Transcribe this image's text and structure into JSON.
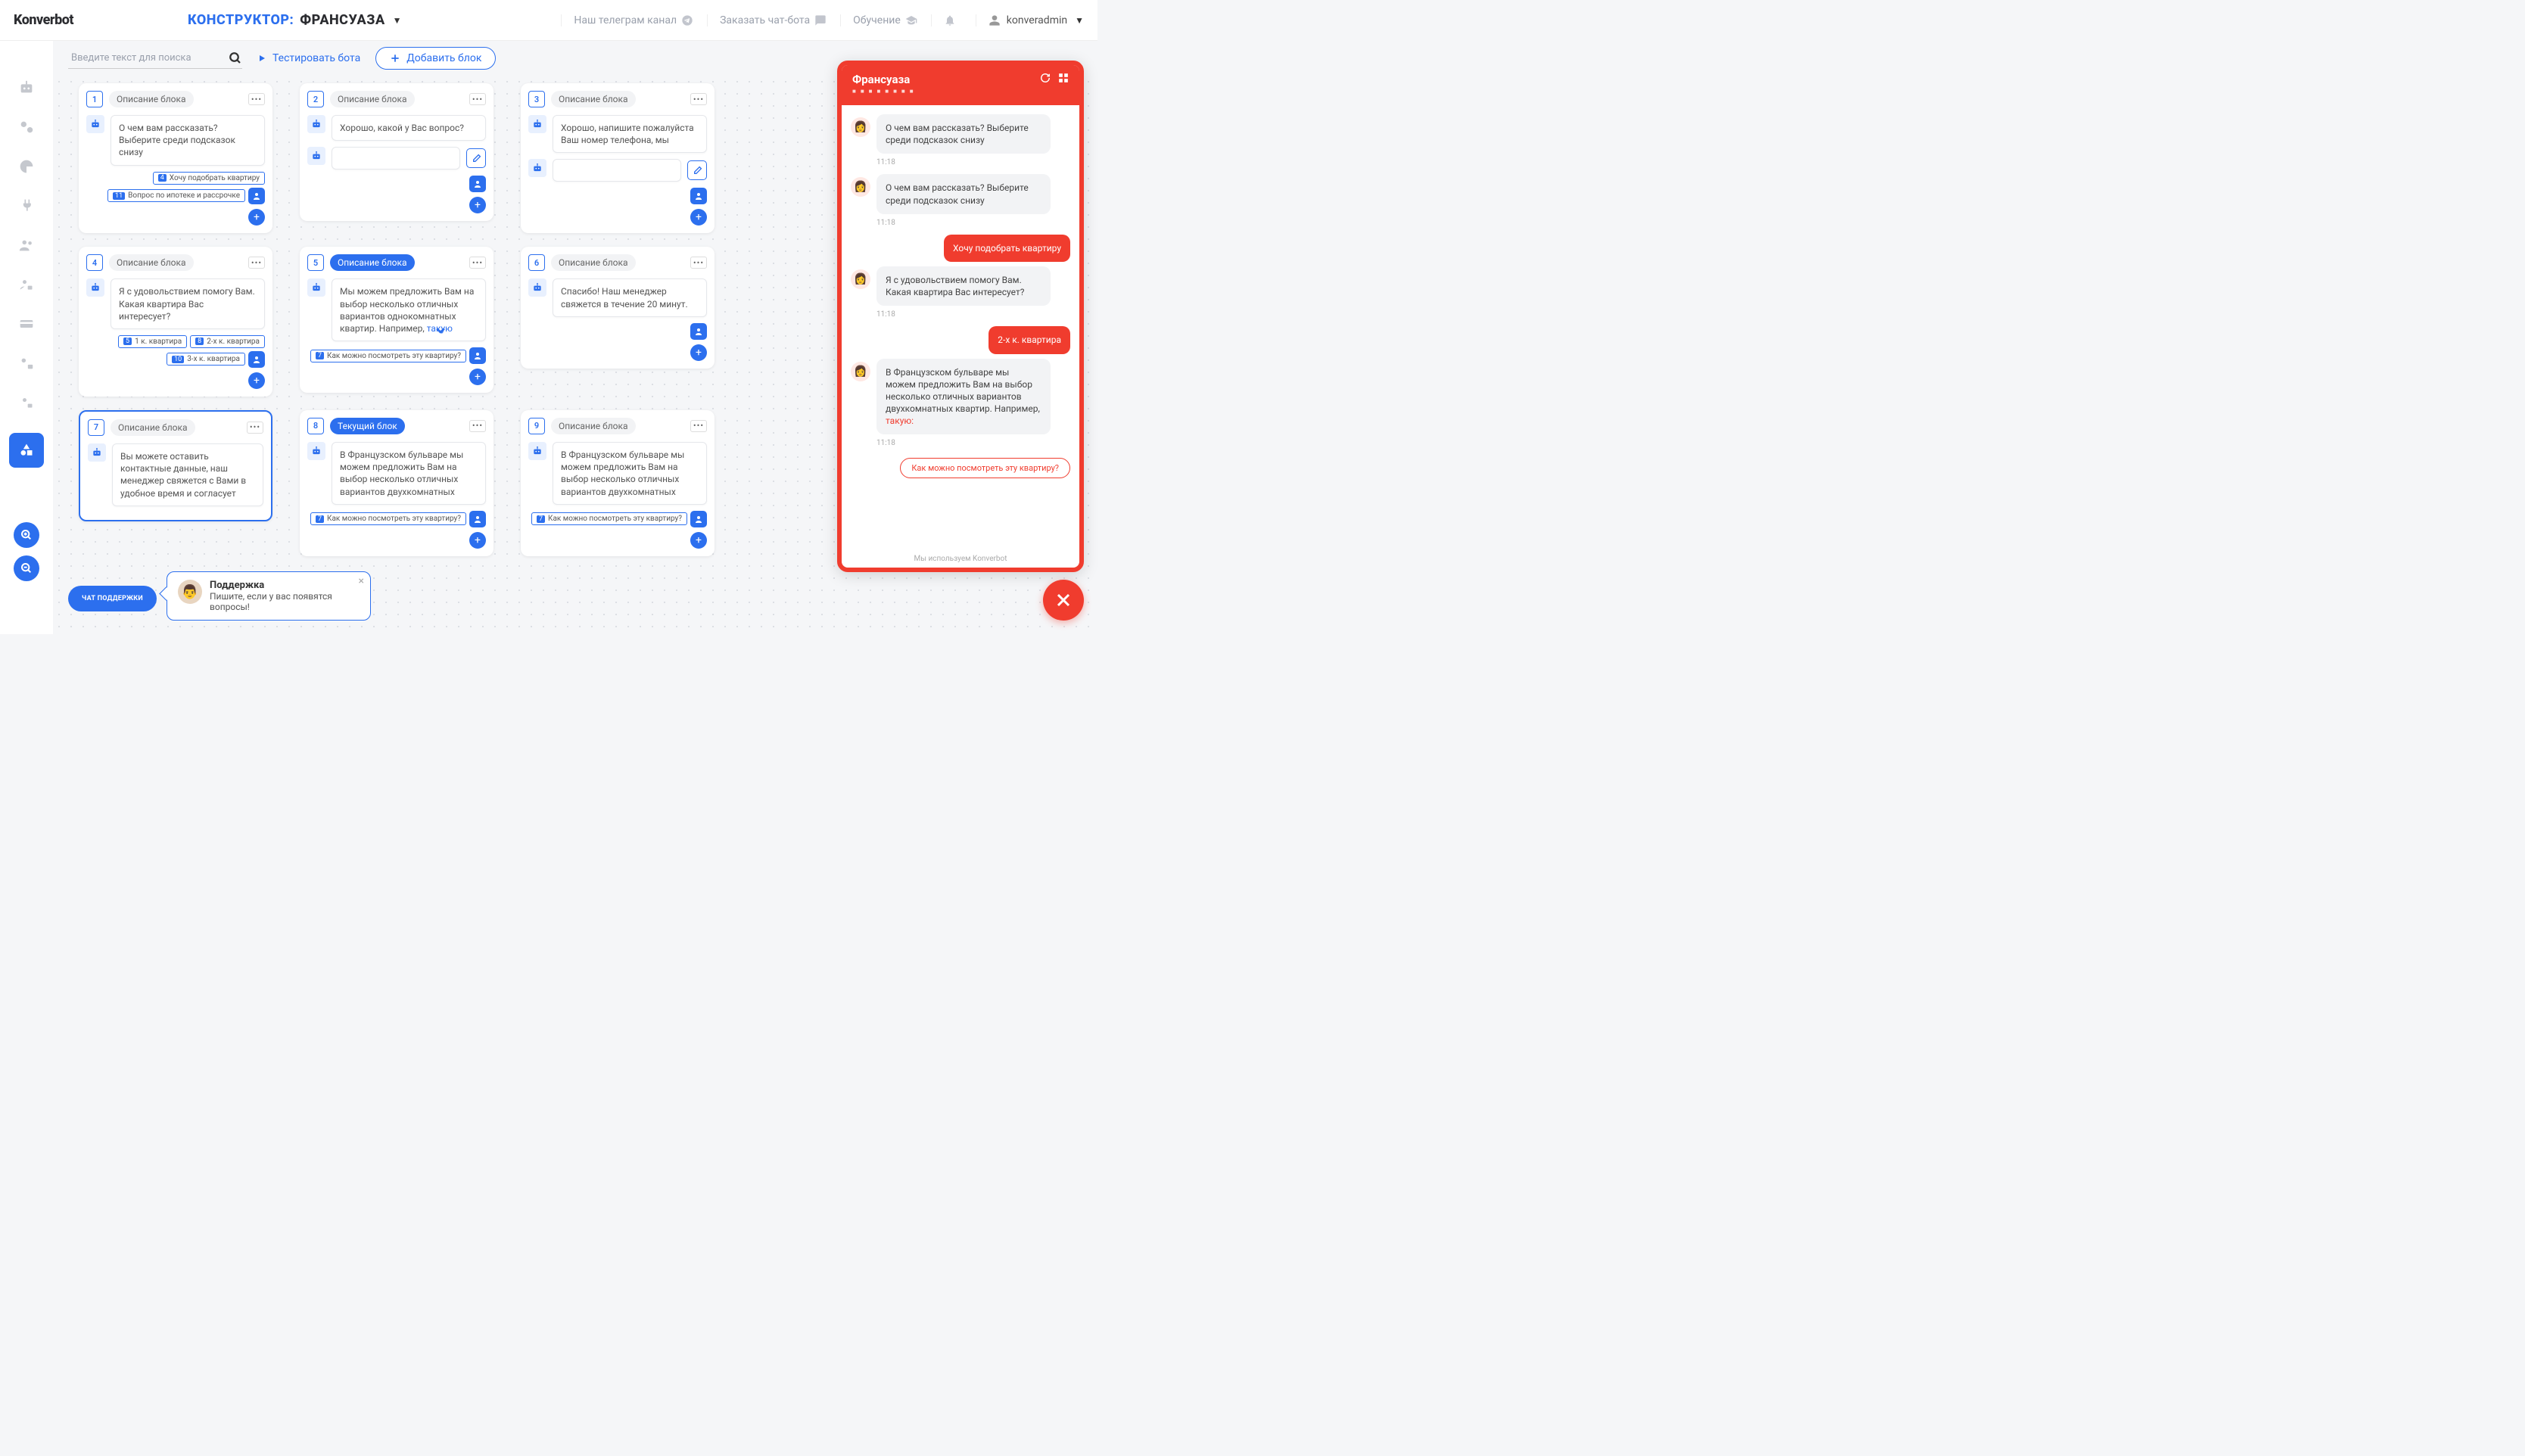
{
  "logo": "Konverbot",
  "title_label": "КОНСТРУКТОР:",
  "title_name": "ФРАНСУАЗА",
  "header_links": {
    "telegram": "Наш телеграм канал",
    "order": "Заказать чат-бота",
    "learn": "Обучение"
  },
  "username": "konveradmin",
  "search_placeholder": "Введите текст для поиска",
  "test_label": "Тестировать бота",
  "add_label": "Добавить блок",
  "chip_default": "Описание блока",
  "chip_current": "Текущий блок",
  "cards": [
    {
      "num": "1",
      "chip": "Описание блока",
      "msg": "О чем вам рассказать? Выберите среди подсказок снизу",
      "opts": [
        [
          "4",
          "Хочу подобрать квартиру"
        ],
        [
          "11",
          "Вопрос по ипотеке и рассрочке"
        ]
      ],
      "input": false
    },
    {
      "num": "2",
      "chip": "Описание блока",
      "msg": "Хорошо, какой у Вас вопрос?",
      "opts": [],
      "input": true
    },
    {
      "num": "3",
      "chip": "Описание блока",
      "msg": "Хорошо, напишите пожалуйста Ваш номер телефона, мы",
      "opts": [],
      "input": true
    },
    {
      "num": "4",
      "chip": "Описание блока",
      "msg": "Я с удовольствием помогу Вам. Какая квартира Вас интересует?",
      "opts": [
        [
          "5",
          "1 к. квартира"
        ],
        [
          "8",
          "2-х к. квартира"
        ],
        [
          "10",
          "3-х к. квартира"
        ]
      ],
      "input": false
    },
    {
      "num": "5",
      "chip": "Описание блока",
      "chip_active": true,
      "msg": "Мы можем предложить Вам на выбор несколько отличных вариантов однокомнатных квартир. Например, ",
      "link": "такую",
      "opts": [
        [
          "7",
          "Как можно посмотреть эту квартиру?"
        ]
      ],
      "input": false
    },
    {
      "num": "6",
      "chip": "Описание блока",
      "msg": "Спасибо! Наш менеджер свяжется в течение 20 минут.",
      "opts": [],
      "input": false,
      "bare_foot": true
    },
    {
      "num": "7",
      "chip": "Описание блока",
      "selected": true,
      "msg": "Вы можете оставить контактные данные, наш менеджер свяжется с Вами в удобное время и согласует",
      "opts": [],
      "input": false
    },
    {
      "num": "8",
      "chip": "Текущий блок",
      "chip_active": true,
      "msg": "В Французском бульваре мы можем предложить Вам на выбор несколько отличных вариантов двухкомнатных",
      "opts": [
        [
          "7",
          "Как можно посмотреть эту квартиру?"
        ]
      ],
      "input": false
    },
    {
      "num": "9",
      "chip": "Описание блока",
      "msg": "В Французском бульваре мы можем предложить Вам на выбор несколько отличных вариантов двухкомнатных",
      "opts": [
        [
          "7",
          "Как можно посмотреть эту квартиру?"
        ]
      ],
      "input": false
    }
  ],
  "zoom": {
    "in": "+",
    "out": "−"
  },
  "support_pill": "ЧАТ ПОДДЕРЖКИ",
  "support_pop": {
    "title": "Поддержка",
    "sub": "Пишите, если у вас появятся вопросы!"
  },
  "preview": {
    "title": "Франсуаза",
    "footer": "Мы используем Konverbot",
    "messages": [
      {
        "type": "bot",
        "text": "О чем вам рассказать? Выберите среди подсказок снизу",
        "time": "11:18"
      },
      {
        "type": "bot",
        "text": "О чем вам рассказать? Выберите среди подсказок снизу",
        "time": "11:18"
      },
      {
        "type": "user",
        "text": "Хочу подобрать квартиру"
      },
      {
        "type": "bot",
        "text": "Я с удовольствием помогу Вам. Какая квартира Вас интересует?",
        "time": "11:18"
      },
      {
        "type": "user",
        "text": "2-х к. квартира"
      },
      {
        "type": "bot",
        "text": "В Французском бульваре мы можем предложить Вам на выбор несколько отличных вариантов двухкомнатных квартир. Например, ",
        "link": "такую:",
        "time": "11:18"
      }
    ],
    "action": "Как можно посмотреть эту квартиру?"
  }
}
